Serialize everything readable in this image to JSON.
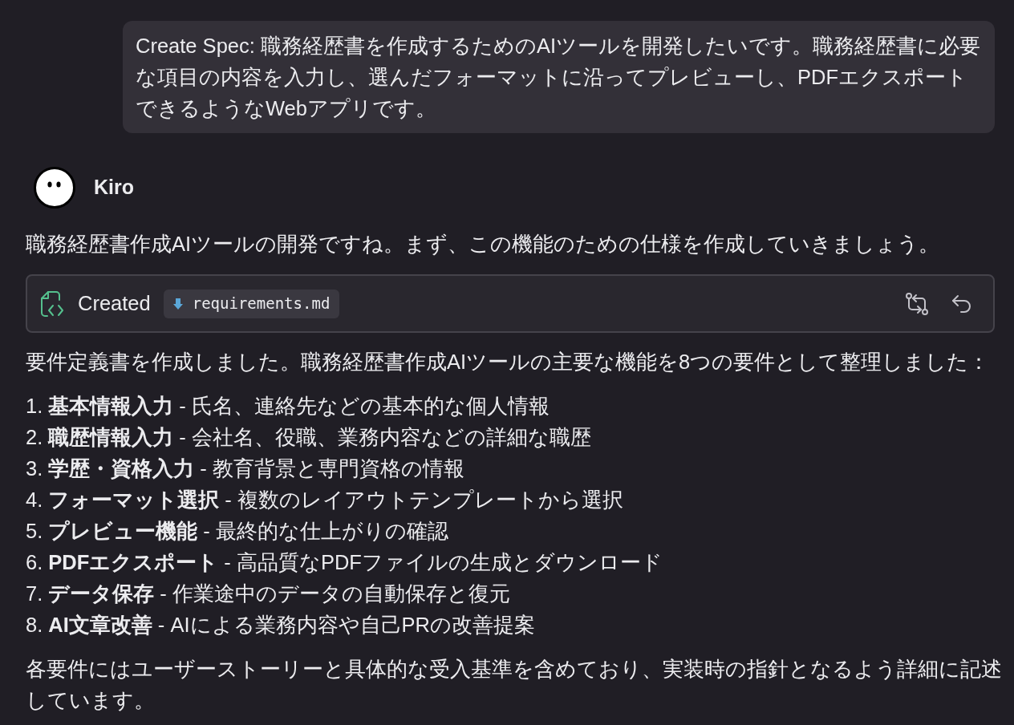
{
  "user_message": {
    "text": "Create Spec: 職務経歴書を作成するためのAIツールを開発したいです。職務経歴書に必要な項目の内容を入力し、選んだフォーマットに沿ってプレビューし、PDFエクスポートできるようなWebアプリです。"
  },
  "assistant": {
    "name": "Kiro"
  },
  "intro": "職務経歴書作成AIツールの開発ですね。まず、この機能のための仕様を作成していきましょう。",
  "action_card": {
    "status": "Created",
    "file": "requirements.md"
  },
  "summary": "要件定義書を作成しました。職務経歴書作成AIツールの主要な機能を8つの要件として整理しました：",
  "requirements": [
    {
      "number": "1.",
      "text": "**基本情報入力** - 氏名、連絡先などの基本的な個人情報"
    },
    {
      "number": "2.",
      "text": "**職歴情報入力** - 会社名、役職、業務内容などの詳細な職歴"
    },
    {
      "number": "3.",
      "text": "**学歴・資格入力** - 教育背景と専門資格の情報"
    },
    {
      "number": "4.",
      "text": "**フォーマット選択** - 複数のレイアウトテンプレートから選択"
    },
    {
      "number": "5.",
      "text": "**プレビュー機能** - 最終的な仕上がりの確認"
    },
    {
      "number": "6.",
      "text": "**PDFエクスポート** - 高品質なPDFファイルの生成とダウンロード"
    },
    {
      "number": "7.",
      "text": "**データ保存** - 作業途中のデータの自動保存と復元"
    },
    {
      "number": "8.",
      "text": "**AI文章改善** - AIによる業務内容や自己PRの改善提案"
    }
  ],
  "closing": "各要件にはユーザーストーリーと具体的な受入基準を含めており、実装時の指針となるよう詳細に記述しています。"
}
